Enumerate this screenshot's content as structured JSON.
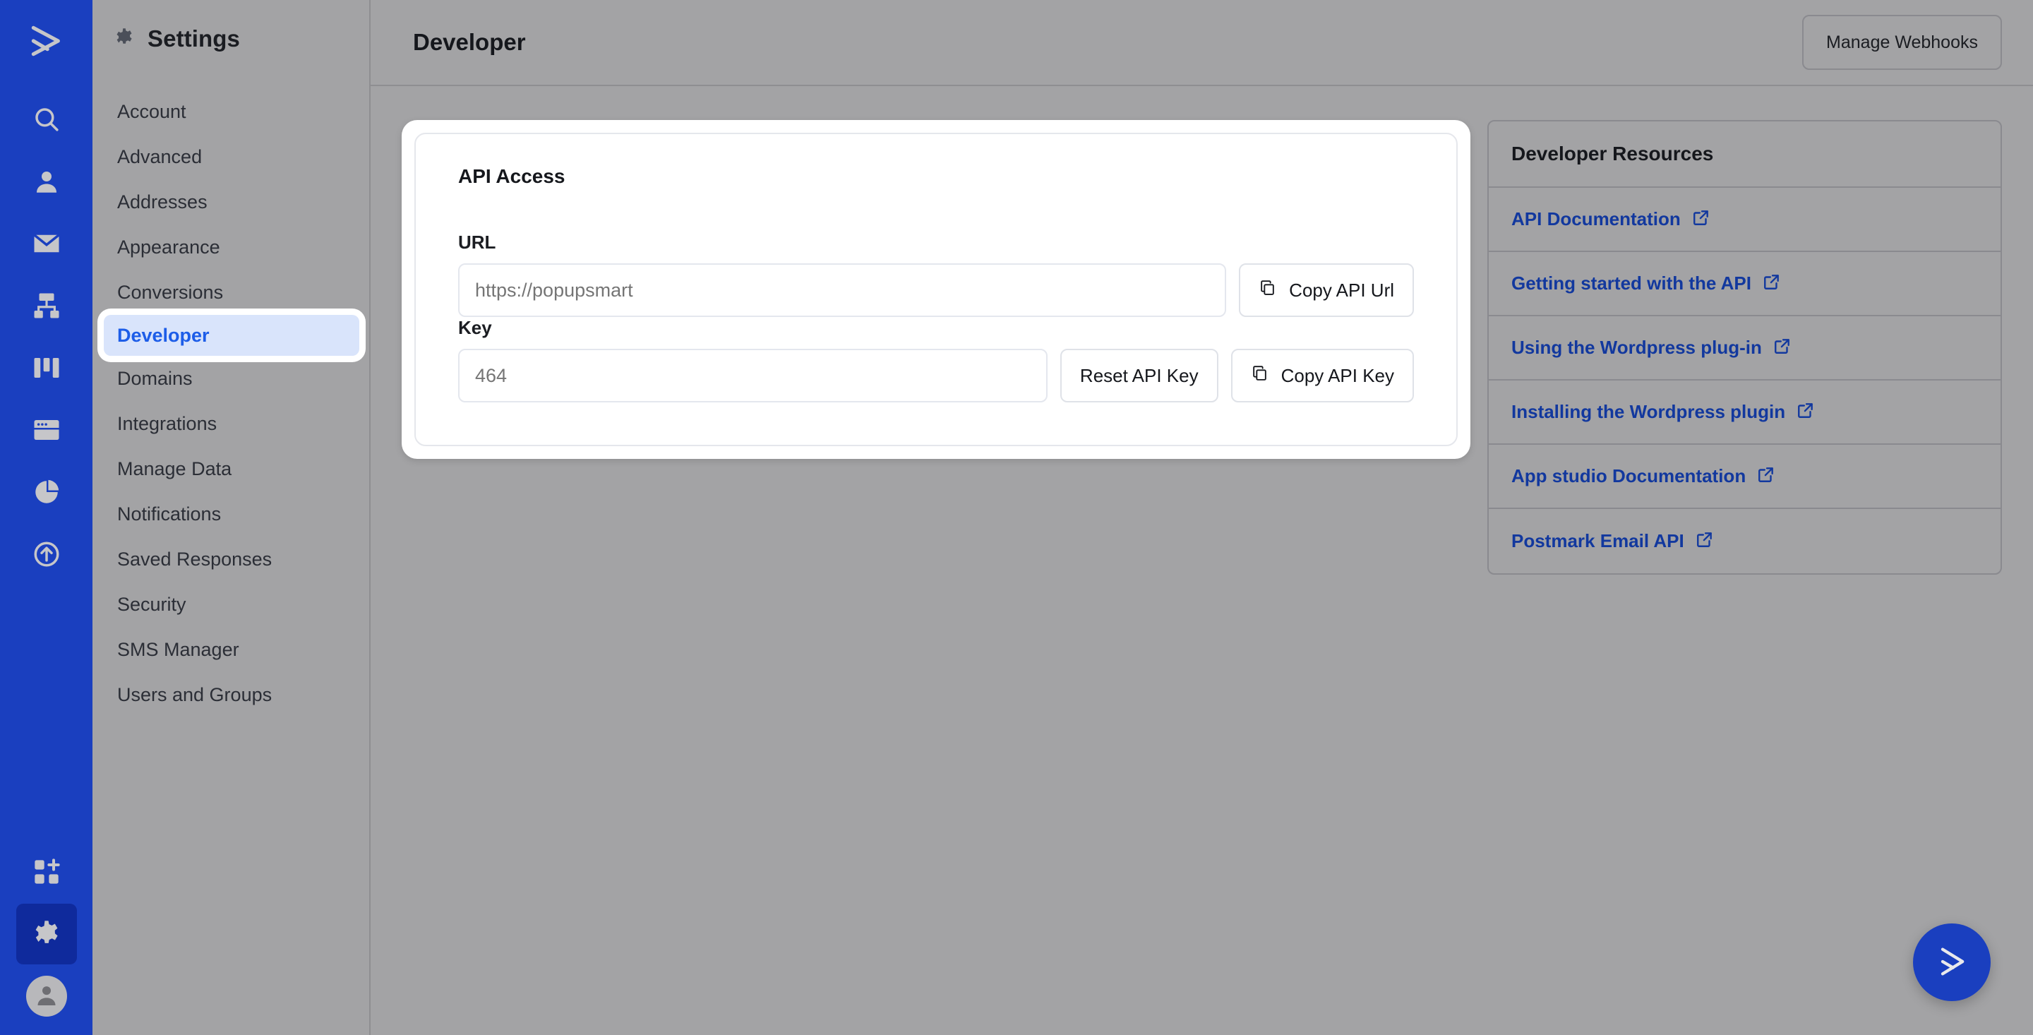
{
  "brand": {
    "rail_color": "#1a3fbf",
    "accent_blue": "#1d5de8",
    "link_blue": "#12389e"
  },
  "rail": {
    "logo": "activecampaign-logo-icon",
    "items": [
      {
        "name": "search-icon",
        "label": "Search"
      },
      {
        "name": "contacts-icon",
        "label": "Contacts"
      },
      {
        "name": "email-icon",
        "label": "Campaigns"
      },
      {
        "name": "automations-icon",
        "label": "Automations"
      },
      {
        "name": "deals-icon",
        "label": "Deals"
      },
      {
        "name": "pages-icon",
        "label": "Pages"
      },
      {
        "name": "reports-icon",
        "label": "Reports"
      },
      {
        "name": "upgrade-icon",
        "label": "Upgrade"
      }
    ],
    "bottom": [
      {
        "name": "apps-icon",
        "label": "Apps"
      },
      {
        "name": "gear-icon",
        "label": "Settings",
        "active": true
      },
      {
        "name": "avatar-icon",
        "label": "Account"
      }
    ]
  },
  "settings": {
    "title": "Settings",
    "icon": "gear-icon",
    "items": [
      {
        "label": "Account",
        "active": false
      },
      {
        "label": "Advanced",
        "active": false
      },
      {
        "label": "Addresses",
        "active": false
      },
      {
        "label": "Appearance",
        "active": false
      },
      {
        "label": "Conversions",
        "active": false
      },
      {
        "label": "Developer",
        "active": true
      },
      {
        "label": "Domains",
        "active": false
      },
      {
        "label": "Integrations",
        "active": false
      },
      {
        "label": "Manage Data",
        "active": false
      },
      {
        "label": "Notifications",
        "active": false
      },
      {
        "label": "Saved Responses",
        "active": false
      },
      {
        "label": "Security",
        "active": false
      },
      {
        "label": "SMS Manager",
        "active": false
      },
      {
        "label": "Users and Groups",
        "active": false
      }
    ]
  },
  "header": {
    "title": "Developer",
    "manage_webhooks_label": "Manage Webhooks"
  },
  "api_access": {
    "title": "API Access",
    "url": {
      "label": "URL",
      "value": "",
      "placeholder": "https://popupsmart",
      "copy_label": "Copy API Url",
      "copy_icon": "copy-icon"
    },
    "key": {
      "label": "Key",
      "value": "",
      "placeholder": "464",
      "reset_label": "Reset API Key",
      "copy_label": "Copy API Key",
      "copy_icon": "copy-icon"
    }
  },
  "resources": {
    "title": "Developer Resources",
    "external_icon": "external-link-icon",
    "links": [
      {
        "label": "API Documentation"
      },
      {
        "label": "Getting started with the API"
      },
      {
        "label": "Using the Wordpress plug-in"
      },
      {
        "label": "Installing the Wordpress plugin"
      },
      {
        "label": "App studio Documentation"
      },
      {
        "label": "Postmark Email API"
      }
    ]
  },
  "fab": {
    "name": "activecampaign-chat-fab",
    "icon": "chevron-right-logo-icon"
  }
}
